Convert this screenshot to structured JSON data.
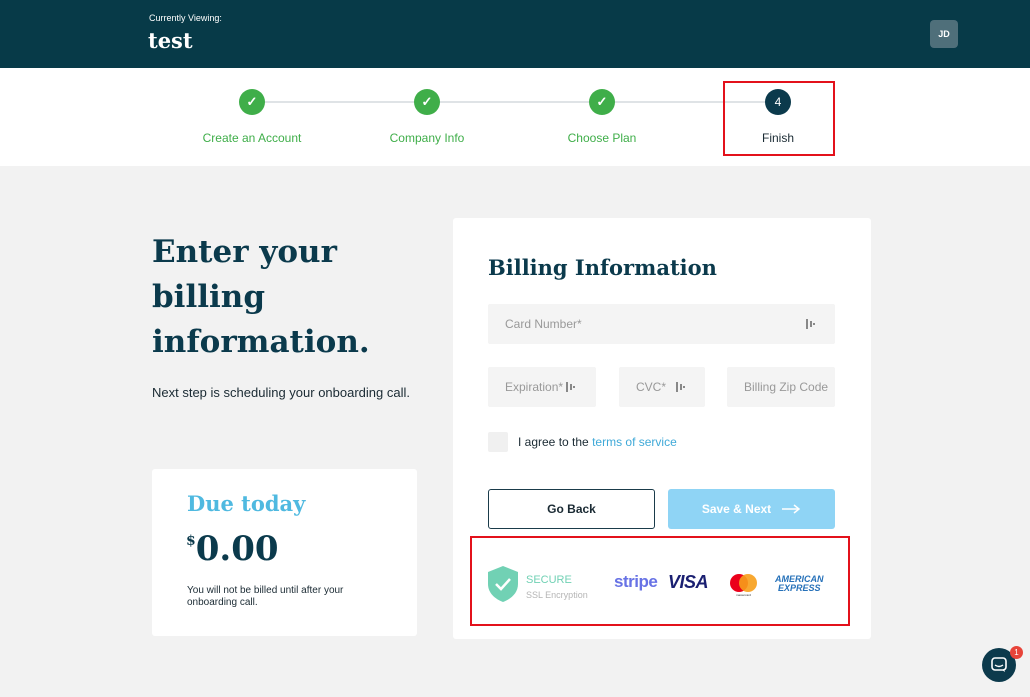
{
  "header": {
    "viewing_label": "Currently Viewing:",
    "viewing_value": "test",
    "avatar_initials": "JD"
  },
  "stepper": {
    "steps": [
      {
        "label": "Create an Account",
        "state": "done",
        "icon": "check-icon"
      },
      {
        "label": "Company Info",
        "state": "done",
        "icon": "check-icon"
      },
      {
        "label": "Choose Plan",
        "state": "done",
        "icon": "check-icon"
      },
      {
        "label": "Finish",
        "state": "current",
        "number": "4"
      }
    ],
    "check_glyph": "✓"
  },
  "intro": {
    "heading": "Enter your billing information.",
    "subtext": "Next step is scheduling your onboarding call."
  },
  "due": {
    "title": "Due today",
    "currency": "$",
    "amount": "0.00",
    "note": "You will not be billed until after your onboarding call."
  },
  "billing": {
    "title": "Billing Information",
    "card_number_placeholder": "Card Number*",
    "expiration_placeholder": "Expiration*",
    "cvc_placeholder": "CVC*",
    "zip_placeholder": "Billing Zip Code",
    "terms_prefix": "I agree to the ",
    "terms_link": "terms of service",
    "back_label": "Go Back",
    "next_label": "Save & Next"
  },
  "security": {
    "secure_label": "SECURE",
    "ssl_label": "SSL Encryption",
    "stripe_label": "stripe",
    "visa_label": "VISA",
    "mastercard_label": "mastercard",
    "amex_line1": "AMERICAN",
    "amex_line2": "EXPRESS"
  },
  "chat": {
    "unread_count": "1"
  },
  "colors": {
    "header_bg": "#073a48",
    "step_done": "#3fae49",
    "step_current": "#0b3a4c",
    "accent_blue": "#4fb9e0",
    "link": "#3fa9d8",
    "button_next": "#8fd4f5",
    "secure_green": "#71d1b4",
    "highlight_red": "#e3111b"
  }
}
